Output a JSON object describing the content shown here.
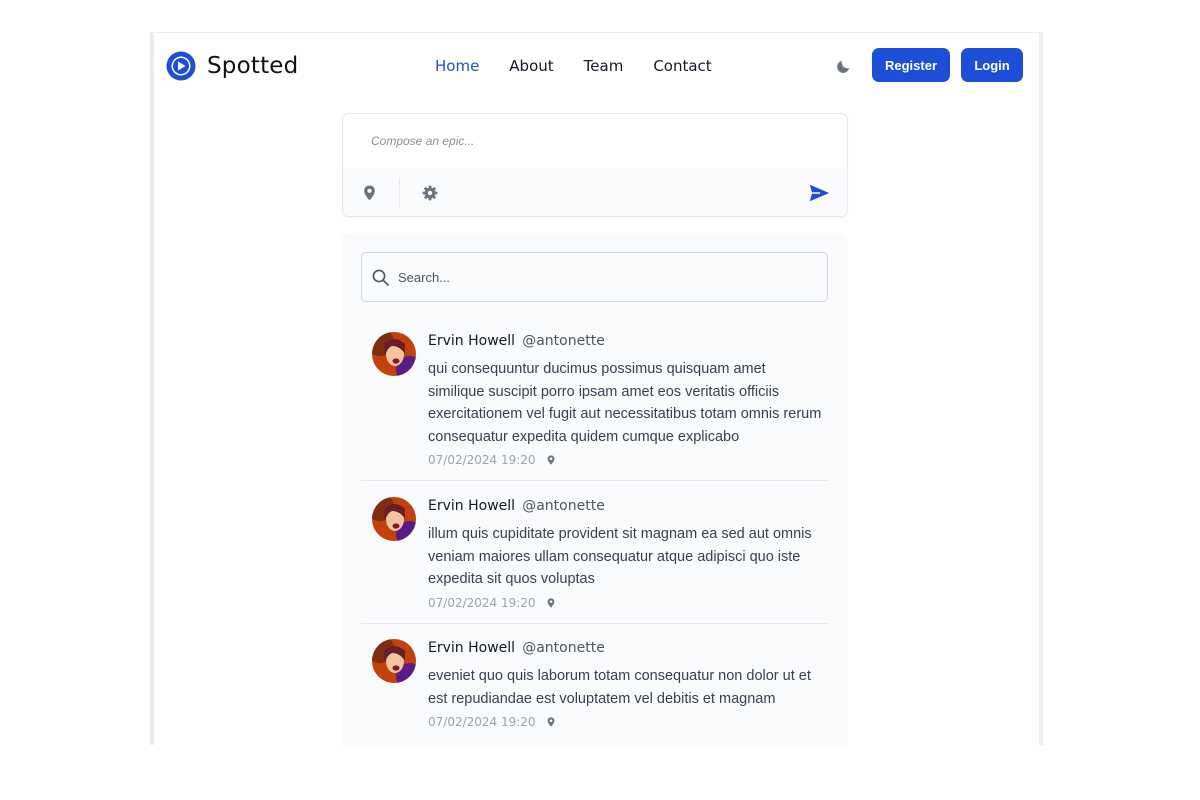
{
  "brand": {
    "name": "Spotted"
  },
  "nav": {
    "links": [
      {
        "label": "Home",
        "active": true
      },
      {
        "label": "About",
        "active": false
      },
      {
        "label": "Team",
        "active": false
      },
      {
        "label": "Contact",
        "active": false
      }
    ],
    "register_label": "Register",
    "login_label": "Login"
  },
  "composer": {
    "placeholder": "Compose an epic...",
    "value": ""
  },
  "feed": {
    "search_placeholder": "Search...",
    "posts": [
      {
        "name": "Ervin Howell",
        "handle": "@antonette",
        "text": "qui consequuntur ducimus possimus quisquam amet similique suscipit porro ipsam amet eos veritatis officiis exercitationem vel fugit aut necessitatibus totam omnis rerum consequatur expedita quidem cumque explicabo",
        "time": "07/02/2024 19:20"
      },
      {
        "name": "Ervin Howell",
        "handle": "@antonette",
        "text": "illum quis cupiditate provident sit magnam ea sed aut omnis veniam maiores ullam consequatur atque adipisci quo iste expedita sit quos voluptas",
        "time": "07/02/2024 19:20"
      },
      {
        "name": "Ervin Howell",
        "handle": "@antonette",
        "text": "eveniet quo quis laborum totam consequatur non dolor ut et est repudiandae est voluptatem vel debitis et magnam",
        "time": "07/02/2024 19:20"
      }
    ]
  },
  "colors": {
    "accent": "#1d4ed8",
    "icon_gray": "#6b7280",
    "feed_bg": "#f9fafb"
  },
  "icons": {
    "logo": "play-circle-icon",
    "theme": "moon-icon",
    "location": "map-pin-icon",
    "settings": "gear-icon",
    "send": "paper-plane-icon",
    "search": "search-icon"
  }
}
